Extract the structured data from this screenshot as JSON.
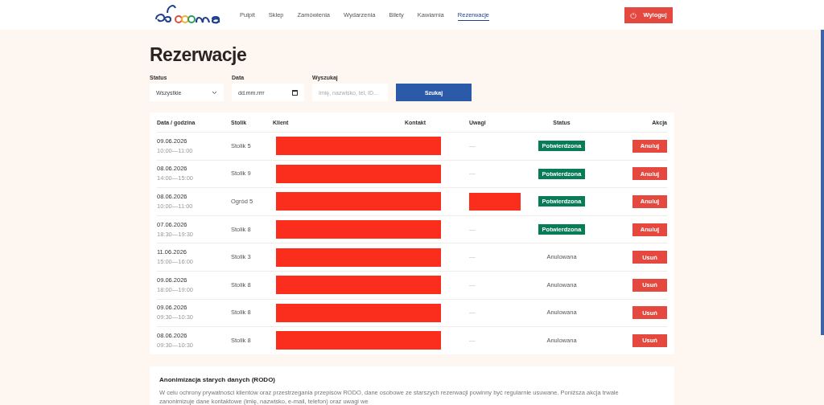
{
  "nav": {
    "items": [
      {
        "label": "Pulpit",
        "selected": false
      },
      {
        "label": "Sklep",
        "selected": false
      },
      {
        "label": "Zamówienia",
        "selected": false
      },
      {
        "label": "Wydarzenia",
        "selected": false
      },
      {
        "label": "Bilety",
        "selected": false
      },
      {
        "label": "Kawiarnia",
        "selected": false
      },
      {
        "label": "Rezerwacje",
        "selected": true
      }
    ],
    "logout": "Wyloguj"
  },
  "title": "Rezerwacje",
  "filters": {
    "status": {
      "label": "Status",
      "value": "Wszystkie"
    },
    "date": {
      "label": "Data",
      "placeholder": "dd.mm.rrrr"
    },
    "search": {
      "label": "Wyszukaj",
      "placeholder": "Imię, nazwisko, tel, ID..."
    },
    "button": "Szukaj"
  },
  "table": {
    "columns": [
      "Data / godzina",
      "Stolik",
      "Klient",
      "Kontakt",
      "Uwagi",
      "Status",
      "Akcja"
    ],
    "rows": [
      {
        "date": "09.06.2026",
        "time": "10:00—11:00",
        "table": "Stolik 5",
        "contact_redacted": true,
        "notes_redacted": false,
        "notes": "—",
        "status": {
          "kind": "confirmed",
          "label": "Potwierdzona"
        },
        "action": "Anuluj"
      },
      {
        "date": "08.06.2026",
        "time": "14:00—15:00",
        "table": "Stolik 9",
        "contact_redacted": true,
        "notes_redacted": false,
        "notes": "—",
        "status": {
          "kind": "confirmed",
          "label": "Potwierdzona"
        },
        "action": "Anuluj"
      },
      {
        "date": "08.06.2026",
        "time": "10:00—11:00",
        "table": "Ogród 5",
        "contact_redacted": true,
        "notes_redacted": true,
        "status": {
          "kind": "confirmed",
          "label": "Potwierdzona"
        },
        "action": "Anuluj"
      },
      {
        "date": "07.06.2026",
        "time": "18:30—19:30",
        "table": "Stolik 8",
        "contact_redacted": true,
        "notes_redacted": false,
        "notes": "—",
        "status": {
          "kind": "confirmed",
          "label": "Potwierdzona"
        },
        "action": "Anuluj"
      },
      {
        "date": "11.06.2026",
        "time": "15:00—16:00",
        "table": "Stolik 3",
        "contact_redacted": true,
        "notes_redacted": false,
        "notes": "—",
        "status": {
          "kind": "cancelled",
          "label": "Anulowana"
        },
        "action": "Usuń"
      },
      {
        "date": "09.06.2026",
        "time": "18:00—19:00",
        "table": "Stolik 8",
        "contact_redacted": true,
        "notes_redacted": false,
        "notes": "—",
        "status": {
          "kind": "cancelled",
          "label": "Anulowana"
        },
        "action": "Usuń"
      },
      {
        "date": "09.06.2026",
        "time": "09:30—10:30",
        "table": "Stolik 8",
        "contact_redacted": true,
        "notes_redacted": false,
        "notes": "—",
        "status": {
          "kind": "cancelled",
          "label": "Anulowana"
        },
        "action": "Usuń"
      },
      {
        "date": "08.06.2026",
        "time": "09:30—10:30",
        "table": "Stolik 8",
        "contact_redacted": true,
        "notes_redacted": false,
        "notes": "—",
        "status": {
          "kind": "cancelled",
          "label": "Anulowana"
        },
        "action": "Usuń"
      }
    ]
  },
  "gdpr": {
    "title": "Anonimizacja starych danych (RODO)",
    "text": "W celu ochrony prywatności klientów oraz przestrzegania przepisów RODO, dane osobowe ze starszych rezerwacji powinny być regularnie usuwane. Poniższa akcja trwale zanonimizuje dane kontaktowe (imię, nazwisko, e-mail, telefon) oraz uwagi we"
  }
}
